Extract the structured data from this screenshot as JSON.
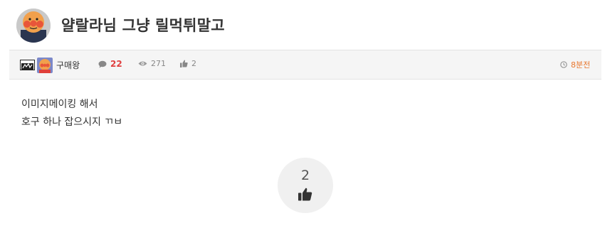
{
  "post": {
    "title": "얄랄라님 그냥 릴먹튀말고",
    "author": "구매왕",
    "comment_count": "22",
    "view_count": "271",
    "like_count": "2",
    "time_ago": "8분전",
    "content_lines": [
      "이미지메이킹 해서",
      "호구 하나 잡으시지 ㄲㅂ"
    ]
  },
  "vote": {
    "count": "2"
  },
  "icons": {
    "avatar": "anpanman-avatar",
    "comment": "comment-icon",
    "view": "eye-icon",
    "like": "thumbs-up-icon",
    "time": "clock-icon",
    "vote": "thumbs-up-icon"
  },
  "colors": {
    "comment_count": "#e04040",
    "time": "#e8772e",
    "meta_text": "#888888",
    "vote_bg": "#f0f0f0"
  }
}
